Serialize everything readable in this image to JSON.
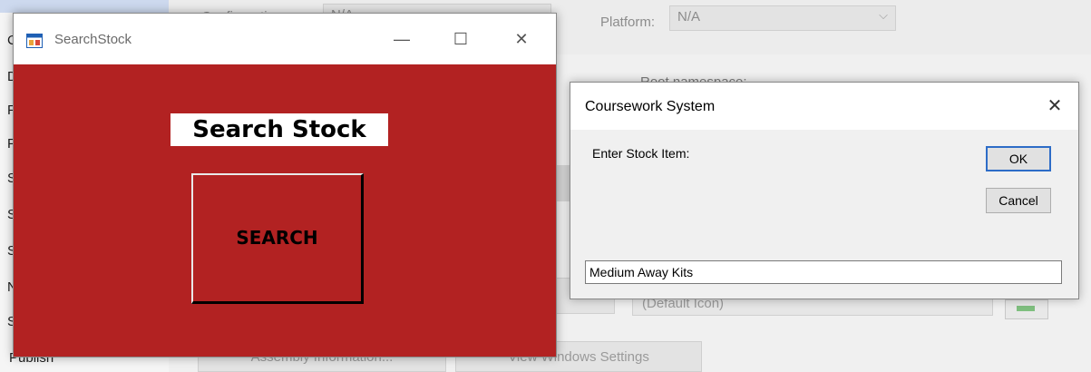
{
  "background": {
    "configuration_label": "Configuration:",
    "configuration_value": "N/A",
    "platform_label": "Platform:",
    "platform_value": "N/A",
    "root_namespace_label": "Root namespace:",
    "icon_field_value": "(Default Icon)",
    "assembly_button": "Assembly Information...",
    "view_windows_button": "View Windows Settings",
    "publish_item": "Publish",
    "nav_letters": [
      "C",
      "D",
      "F",
      "F",
      "S",
      "S",
      "S",
      "N",
      "S"
    ]
  },
  "search_window": {
    "title": "SearchStock",
    "heading": "Search Stock",
    "search_button": "SEARCH",
    "minimize_glyph": "—",
    "maximize_glyph": "☐",
    "close_glyph": "✕",
    "form_color": "#b22222"
  },
  "dialog": {
    "title": "Coursework System",
    "close_glyph": "✕",
    "prompt": "Enter Stock Item:",
    "ok_label": "OK",
    "cancel_label": "Cancel",
    "input_value": "Medium Away Kits"
  }
}
